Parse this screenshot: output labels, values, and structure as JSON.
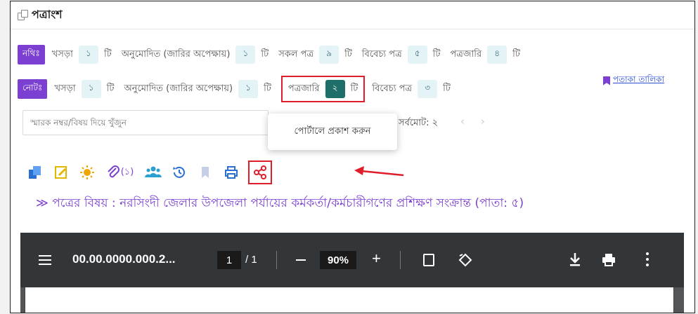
{
  "header": {
    "title": "পত্রাংশ",
    "icon": "copy-icon"
  },
  "nothi_row": {
    "tag": "নথিঃ",
    "unit": "টি",
    "items": [
      {
        "label": "খসড়া",
        "count": "১"
      },
      {
        "label": "অনুমোদিত (জারির অপেক্ষায়)",
        "count": "১"
      },
      {
        "label": "সকল পত্র",
        "count": "৯"
      },
      {
        "label": "বিবেচ্য পত্র",
        "count": "৫"
      },
      {
        "label": "পত্রজারি",
        "count": "৪"
      }
    ]
  },
  "note_row": {
    "tag": "নোটঃ",
    "unit": "টি",
    "items": [
      {
        "label": "খসড়া",
        "count": "১"
      },
      {
        "label": "অনুমোদিত (জারির অপেক্ষায়)",
        "count": "১"
      },
      {
        "label": "পত্রজারি",
        "count": "২",
        "highlighted": true
      },
      {
        "label": "বিবেচ্য পত্র",
        "count": "৩"
      }
    ]
  },
  "flag_link": "পতাকা তালিকা",
  "search": {
    "placeholder": "স্মারক নম্বর/বিষয় দিয়ে খুঁজুন",
    "value": ""
  },
  "total": "সর্বমোট: ২",
  "pager": {
    "prev": "‹",
    "next": "›"
  },
  "tooltip": "পোর্টালে প্রকাশ করুন",
  "toolbar": {
    "attachments_count": "(১)",
    "icons": [
      "copy-icon",
      "edit-icon",
      "sun-icon",
      "attachment-icon",
      "users-icon",
      "history-icon",
      "bookmark-icon",
      "print-icon",
      "share-icon"
    ]
  },
  "subject": "≫ পত্রের বিষয় : নরসিংদী জেলার উপজেলা পর্যায়ের কর্মকর্তা/কর্মচারীগণের প্রশিক্ষণ সংক্রান্ত (পাতা: ৫)",
  "pdf": {
    "filename": "00.00.0000.000.2...",
    "page_current": "1",
    "page_total": "/ 1",
    "zoom": "90%",
    "minus": "—",
    "plus": "+"
  },
  "colors": {
    "accent": "#7b3fd2",
    "highlight_border": "#e01e2b",
    "count_bg": "#e3f3f6",
    "count_dark": "#1e6f6a",
    "pdf_bar": "#323639",
    "link": "#2a4fd4"
  }
}
